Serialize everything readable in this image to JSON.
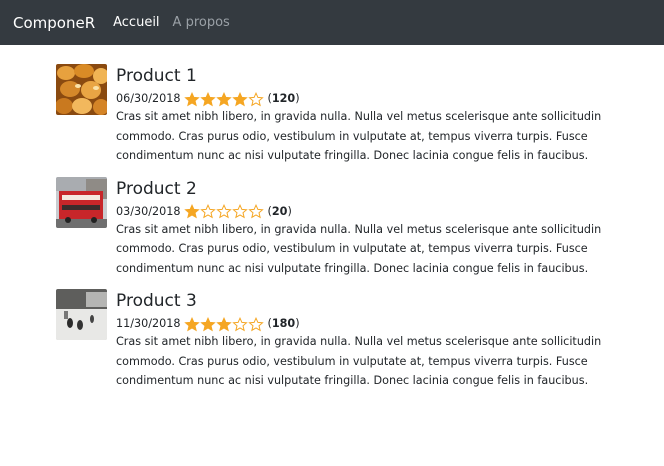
{
  "navbar": {
    "brand": "ComponeR",
    "links": [
      {
        "label": "Accueil",
        "active": true
      },
      {
        "label": "A propos",
        "active": false
      }
    ]
  },
  "products": [
    {
      "title": "Product 1",
      "date": "06/30/2018",
      "rating": 4,
      "count": "120",
      "image_icon": "nuts-photo",
      "description": "Cras sit amet nibh libero, in gravida nulla. Nulla vel metus scelerisque ante sollicitudin commodo. Cras purus odio, vestibulum in vulputate at, tempus viverra turpis. Fusce condimentum nunc ac nisi vulputate fringilla. Donec lacinia congue felis in faucibus."
    },
    {
      "title": "Product 2",
      "date": "03/30/2018",
      "rating": 1,
      "count": "20",
      "image_icon": "red-bus-photo",
      "description": "Cras sit amet nibh libero, in gravida nulla. Nulla vel metus scelerisque ante sollicitudin commodo. Cras purus odio, vestibulum in vulputate at, tempus viverra turpis. Fusce condimentum nunc ac nisi vulputate fringilla. Donec lacinia congue felis in faucibus."
    },
    {
      "title": "Product 3",
      "date": "11/30/2018",
      "rating": 3,
      "count": "180",
      "image_icon": "street-photo",
      "description": "Cras sit amet nibh libero, in gravida nulla. Nulla vel metus scelerisque ante sollicitudin commodo. Cras purus odio, vestibulum in vulputate at, tempus viverra turpis. Fusce condimentum nunc ac nisi vulputate fringilla. Donec lacinia congue felis in faucibus."
    }
  ],
  "max_rating": 5,
  "colors": {
    "navbar_bg": "#343a40",
    "star": "#f5a623"
  }
}
